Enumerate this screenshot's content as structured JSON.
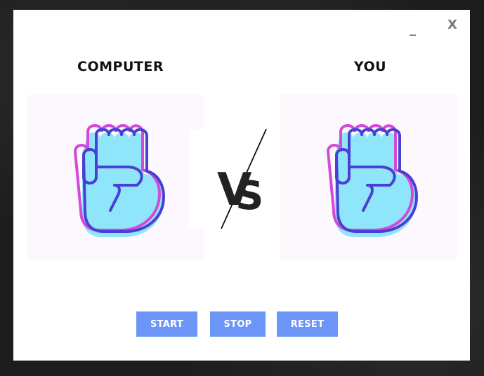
{
  "window": {
    "minimize_label": "_",
    "close_label": "X"
  },
  "players": {
    "computer_label": "COMPUTER",
    "you_label": "YOU",
    "computer_hand": "rock-fist-icon",
    "you_hand": "rock-fist-icon"
  },
  "versus": {
    "icon": "vs-icon"
  },
  "controls": {
    "start_label": "START",
    "stop_label": "STOP",
    "reset_label": "RESET"
  },
  "colors": {
    "button_bg": "#6b96f8",
    "fist_fill": "#8fe6fb",
    "fist_outline": "#4a3fd4",
    "fist_accent": "#d24ad6"
  }
}
